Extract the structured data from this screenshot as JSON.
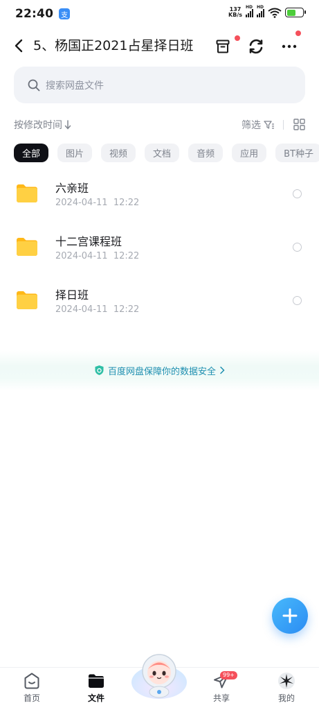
{
  "status_bar": {
    "time": "22:40",
    "app_icon": "支",
    "net_speed_value": "137",
    "net_speed_unit": "KB/s",
    "hd_label_1": "HD",
    "hd_label_2": "HD",
    "battery_level": 0.55,
    "battery_color": "#4ccd3a"
  },
  "header": {
    "title": "5、杨国正2021占星择日班"
  },
  "search": {
    "placeholder": "搜索网盘文件"
  },
  "sort": {
    "label": "按修改时间",
    "filter_label": "筛选"
  },
  "chips": [
    {
      "label": "全部",
      "active": true
    },
    {
      "label": "图片"
    },
    {
      "label": "视频"
    },
    {
      "label": "文档"
    },
    {
      "label": "音频"
    },
    {
      "label": "应用"
    },
    {
      "label": "BT种子"
    }
  ],
  "files": [
    {
      "name": "六亲班",
      "date": "2024-04-11",
      "time": "12:22"
    },
    {
      "name": "十二宫课程班",
      "date": "2024-04-11",
      "time": "12:22"
    },
    {
      "name": "择日班",
      "date": "2024-04-11",
      "time": "12:22"
    }
  ],
  "security_banner": {
    "text": "百度网盘保障你的数据安全"
  },
  "bottom_nav": {
    "home": "首页",
    "files": "文件",
    "share": "共享",
    "share_badge": "99+",
    "me": "我的"
  },
  "colors": {
    "accent": "#2b8cf3",
    "folder": "#ffc62e",
    "badge": "#f5505b",
    "secure": "#1e8fb0"
  }
}
